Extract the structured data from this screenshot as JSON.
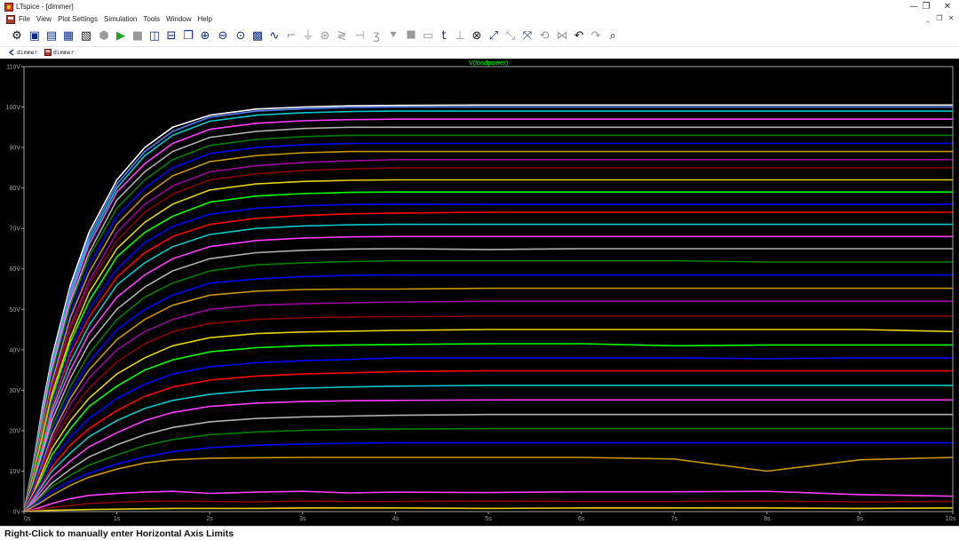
{
  "window": {
    "title": "LTspice - [dimmer]",
    "minimize_label": "—",
    "restore_label": "❐",
    "close_label": "✕"
  },
  "menubar": {
    "items": [
      "File",
      "View",
      "Plot Settings",
      "Simulation",
      "Tools",
      "Window",
      "Help"
    ],
    "mdi_minimize": "_",
    "mdi_restore": "❐",
    "mdi_close": "✕"
  },
  "toolbar": {
    "icons": [
      {
        "name": "control-panel-icon",
        "glyph": "⚙",
        "color": "#111111"
      },
      {
        "name": "new-schematic-icon",
        "glyph": "▣",
        "color": "#0b2d8a"
      },
      {
        "name": "open-file-icon",
        "glyph": "▤",
        "color": "#0b2d8a"
      },
      {
        "name": "save-icon",
        "glyph": "▦",
        "color": "#0b2d8a"
      },
      {
        "name": "print-icon",
        "glyph": "▧",
        "color": "#1a1a1a"
      },
      {
        "name": "halt-icon",
        "glyph": "⬢",
        "color": "#9a9a9a"
      },
      {
        "name": "run-icon",
        "glyph": "▶",
        "color": "#1fa51f"
      },
      {
        "name": "stop-icon",
        "glyph": "■",
        "color": "#9a9a9a"
      },
      {
        "name": "tile-vertical-icon",
        "glyph": "◫",
        "color": "#0b2d8a"
      },
      {
        "name": "tile-horizontal-icon",
        "glyph": "⊟",
        "color": "#0b2d8a"
      },
      {
        "name": "cascade-icon",
        "glyph": "❐",
        "color": "#0b2d8a"
      },
      {
        "name": "zoom-in-icon",
        "glyph": "⊕",
        "color": "#0b2d8a"
      },
      {
        "name": "zoom-out-icon",
        "glyph": "⊖",
        "color": "#0b2d8a"
      },
      {
        "name": "zoom-fit-icon",
        "glyph": "⊙",
        "color": "#0b2d8a"
      },
      {
        "name": "autorange-icon",
        "glyph": "▩",
        "color": "#0b2d8a"
      },
      {
        "name": "waveform-icon",
        "glyph": "∿",
        "color": "#0b2d8a"
      },
      {
        "name": "wire-icon",
        "glyph": "⌐",
        "color": "#9a9a9a"
      },
      {
        "name": "ground-icon",
        "glyph": "⏚",
        "color": "#9a9a9a"
      },
      {
        "name": "label-net-icon",
        "glyph": "⊛",
        "color": "#9a9a9a"
      },
      {
        "name": "resistor-icon",
        "glyph": "≷",
        "color": "#9a9a9a"
      },
      {
        "name": "capacitor-icon",
        "glyph": "⊣",
        "color": "#9a9a9a"
      },
      {
        "name": "inductor-icon",
        "glyph": "ʒ",
        "color": "#9a9a9a"
      },
      {
        "name": "diode-icon",
        "glyph": "⯆",
        "color": "#9a9a9a"
      },
      {
        "name": "component-icon",
        "glyph": "⯀",
        "color": "#9a9a9a"
      },
      {
        "name": "net-name-icon",
        "glyph": "▭",
        "color": "#9a9a9a"
      },
      {
        "name": "text-icon",
        "glyph": "t",
        "color": "#0b2d8a"
      },
      {
        "name": "spice-directive-icon",
        "glyph": "⊥",
        "color": "#9a9a9a"
      },
      {
        "name": "delete-icon",
        "glyph": "⊗",
        "color": "#111111"
      },
      {
        "name": "duplicate-icon",
        "glyph": "⤢",
        "color": "#0b2d8a"
      },
      {
        "name": "move-icon",
        "glyph": "⤡",
        "color": "#9a9a9a"
      },
      {
        "name": "drag-icon",
        "glyph": "⤧",
        "color": "#0b2d8a"
      },
      {
        "name": "rotate-icon",
        "glyph": "⟲",
        "color": "#9a9a9a"
      },
      {
        "name": "mirror-icon",
        "glyph": "⋈",
        "color": "#9a9a9a"
      },
      {
        "name": "undo-icon",
        "glyph": "↶",
        "color": "#111111"
      },
      {
        "name": "redo-icon",
        "glyph": "↷",
        "color": "#9a9a9a"
      },
      {
        "name": "find-icon",
        "glyph": "⌕",
        "color": "#111111"
      }
    ]
  },
  "tabs": [
    {
      "label": "dimmer",
      "icon": "schematic-tab-icon"
    },
    {
      "label": "dimmer",
      "icon": "waveform-tab-icon"
    }
  ],
  "plot": {
    "trace_label": "V(loadpower)",
    "trace_label_color": "#00ff00",
    "background": "#000000",
    "axis_color": "#a0a0a0"
  },
  "status": {
    "message": "Right-Click to manually enter Horizontal Axis Limits"
  },
  "chart_data": {
    "type": "line",
    "title": "V(loadpower)",
    "xlabel": "",
    "ylabel": "",
    "xlim": [
      0,
      10
    ],
    "ylim": [
      0,
      110
    ],
    "x_ticks": [
      "0s",
      "1s",
      "2s",
      "3s",
      "4s",
      "5s",
      "6s",
      "7s",
      "8s",
      "9s",
      "10s"
    ],
    "y_ticks": [
      "0V",
      "10V",
      "20V",
      "30V",
      "40V",
      "50V",
      "60V",
      "70V",
      "80V",
      "90V",
      "100V",
      "110V"
    ],
    "grid": false,
    "legend": "none",
    "x": [
      0,
      0.1,
      0.2,
      0.3,
      0.5,
      0.7,
      1.0,
      1.3,
      1.6,
      2.0,
      2.5,
      3.0,
      3.5,
      4.0,
      5.0,
      6.0,
      7.0,
      8.0,
      9.0,
      10.0
    ],
    "series": [
      {
        "color": "#ffffff",
        "values": [
          0,
          12,
          26,
          38,
          56,
          69,
          82,
          90,
          95,
          98,
          99.5,
          100,
          100.3,
          100.4,
          100.5,
          100.5,
          100.5,
          100.5,
          100.5,
          100.5
        ]
      },
      {
        "color": "#4f7fff",
        "values": [
          0,
          12,
          25,
          37,
          55,
          68,
          81,
          89,
          94,
          97.5,
          99,
          99.6,
          99.9,
          100,
          100,
          100,
          100,
          100,
          100,
          100
        ]
      },
      {
        "color": "#00c8c8",
        "values": [
          0,
          11.5,
          25,
          37,
          54,
          67,
          80,
          88,
          93,
          96.5,
          98,
          98.6,
          98.9,
          99,
          99,
          99,
          99,
          99,
          99,
          99
        ]
      },
      {
        "color": "#ff3cff",
        "values": [
          0,
          11,
          24,
          36,
          53,
          66,
          79,
          86,
          91,
          94.5,
          96,
          96.6,
          96.9,
          97,
          97,
          97,
          97,
          97,
          97,
          97
        ]
      },
      {
        "color": "#b0b0b0",
        "values": [
          0,
          11,
          23,
          35,
          52,
          64,
          77,
          84,
          89,
          92.5,
          94,
          94.7,
          95,
          95,
          95,
          95,
          95,
          95,
          95,
          95
        ]
      },
      {
        "color": "#007f00",
        "values": [
          0,
          10.5,
          22,
          34,
          51,
          63,
          75,
          82,
          87,
          90.5,
          92,
          92.7,
          93,
          93,
          93,
          93,
          93,
          93,
          93,
          93
        ]
      },
      {
        "color": "#0000ff",
        "values": [
          0,
          10,
          21,
          33,
          49,
          61,
          73,
          80,
          85,
          88.5,
          90,
          90.7,
          91,
          91,
          91,
          91,
          91,
          91,
          91,
          91
        ]
      },
      {
        "color": "#c89600",
        "values": [
          0,
          10,
          21,
          32,
          48,
          59,
          71,
          78,
          83,
          86.5,
          88,
          88.7,
          89,
          89,
          89,
          89,
          89,
          89,
          89,
          89
        ]
      },
      {
        "color": "#9b009b",
        "values": [
          0,
          9.5,
          20,
          31,
          46,
          57,
          69,
          76,
          80.5,
          84,
          85.5,
          86.3,
          86.7,
          87,
          87,
          87,
          87,
          87,
          87,
          87
        ]
      },
      {
        "color": "#8b0000",
        "values": [
          0,
          9,
          19,
          30,
          45,
          56,
          67,
          74,
          78.5,
          82,
          83.5,
          84.3,
          84.7,
          85,
          85,
          85,
          85,
          85,
          85,
          85
        ]
      },
      {
        "color": "#e6d200",
        "values": [
          0,
          9,
          19,
          29,
          43,
          54,
          65,
          71.5,
          76,
          79.5,
          81,
          81.6,
          81.9,
          82,
          82,
          82,
          82,
          82,
          82,
          82
        ]
      },
      {
        "color": "#00ff00",
        "values": [
          0,
          8.5,
          18,
          28,
          42,
          52,
          63,
          69,
          73,
          76.5,
          78,
          78.6,
          78.9,
          79,
          79,
          79,
          79,
          79,
          79,
          79
        ]
      },
      {
        "color": "#0000ff",
        "values": [
          0,
          8,
          17,
          27,
          40,
          50,
          60,
          66.5,
          70.5,
          73.5,
          75,
          75.6,
          75.9,
          76,
          76,
          76,
          76,
          76,
          76,
          76
        ]
      },
      {
        "color": "#ff0000",
        "values": [
          0,
          8,
          17,
          26,
          39,
          48,
          58,
          64,
          68,
          71,
          72.5,
          73.2,
          73.6,
          73.8,
          74,
          74,
          74,
          74,
          74,
          74
        ]
      },
      {
        "color": "#00c8c8",
        "values": [
          0,
          7.5,
          16,
          25,
          37,
          46,
          56,
          61.5,
          65.5,
          68.5,
          70,
          70.6,
          70.9,
          71,
          71,
          71,
          71,
          71,
          71,
          71
        ]
      },
      {
        "color": "#ff3cff",
        "values": [
          0,
          7,
          15,
          24,
          35,
          44,
          53,
          58.5,
          62.5,
          65.5,
          67,
          67.6,
          67.9,
          68,
          68,
          68,
          68,
          68,
          68,
          68
        ]
      },
      {
        "color": "#b0b0b0",
        "values": [
          0,
          7,
          14.5,
          22.5,
          33,
          41.5,
          50,
          55.5,
          59.5,
          62.5,
          64,
          64.6,
          64.9,
          65,
          64.8,
          65,
          65,
          65,
          65,
          65
        ]
      },
      {
        "color": "#007f00",
        "values": [
          0,
          6.5,
          13.5,
          21,
          31,
          39,
          47.5,
          53,
          56.5,
          59.5,
          61,
          61.5,
          61.8,
          62,
          62,
          62,
          62,
          61.7,
          61.7,
          61.7
        ]
      },
      {
        "color": "#0000ff",
        "values": [
          0,
          6,
          13,
          20,
          29.5,
          37,
          45,
          50,
          53.5,
          56.5,
          57.5,
          58.1,
          58.4,
          58.5,
          58.5,
          58.5,
          58.5,
          58.5,
          58.5,
          58.5
        ]
      },
      {
        "color": "#c89600",
        "values": [
          0,
          5.5,
          12,
          19,
          28,
          35,
          42.5,
          47.5,
          51,
          53.5,
          54.5,
          54.9,
          55,
          55,
          55.2,
          55.2,
          55.2,
          55.2,
          55.2,
          55.2
        ]
      },
      {
        "color": "#9b009b",
        "values": [
          0,
          5.5,
          11.5,
          18,
          26.5,
          33,
          40,
          44.5,
          47.5,
          50,
          51,
          51.4,
          51.6,
          51.8,
          52,
          52,
          52,
          52,
          52,
          52
        ]
      },
      {
        "color": "#8b0000",
        "values": [
          0,
          5,
          10.5,
          17,
          24.5,
          30.5,
          37,
          41.5,
          44.5,
          46.5,
          47.5,
          47.9,
          48.1,
          48.2,
          48.3,
          48.3,
          48.3,
          48.3,
          48.3,
          48.3
        ]
      },
      {
        "color": "#e6d200",
        "values": [
          0,
          4.5,
          10,
          15.5,
          22.5,
          28,
          34,
          38,
          41,
          43,
          44,
          44.4,
          44.6,
          44.8,
          45,
          45,
          45,
          45,
          45,
          44.5
        ]
      },
      {
        "color": "#00ff00",
        "values": [
          0,
          4,
          9,
          14,
          20.5,
          26,
          31,
          35,
          37.5,
          39.5,
          40.5,
          41,
          41.2,
          41.3,
          41.5,
          41.5,
          41,
          41.2,
          41.2,
          41.2
        ]
      },
      {
        "color": "#0000ff",
        "values": [
          0,
          4,
          8,
          12.5,
          18.5,
          23,
          28,
          31.5,
          34,
          35.8,
          36.8,
          37.3,
          37.6,
          38,
          38,
          38,
          38,
          37.8,
          38,
          38
        ]
      },
      {
        "color": "#ff0000",
        "values": [
          0,
          3.5,
          7,
          11,
          16.5,
          20.5,
          25,
          28.5,
          30.8,
          32.5,
          33.5,
          34,
          34.3,
          34.6,
          34.8,
          34.8,
          34.8,
          34.8,
          34.8,
          34.8
        ]
      },
      {
        "color": "#00c8c8",
        "values": [
          0,
          3,
          6.5,
          10,
          14.5,
          18.5,
          22.5,
          25.5,
          27.5,
          29,
          30,
          30.5,
          30.8,
          31,
          31.2,
          31.2,
          31.2,
          31.2,
          31.2,
          31.2
        ]
      },
      {
        "color": "#ff3cff",
        "values": [
          0,
          2.5,
          5.5,
          8.5,
          12.5,
          16,
          19.5,
          22.5,
          24.5,
          26,
          26.8,
          27.2,
          27.4,
          27.5,
          27.6,
          27.6,
          27.6,
          27.6,
          27.6,
          27.6
        ]
      },
      {
        "color": "#b0b0b0",
        "values": [
          0,
          2,
          4.5,
          7,
          10.5,
          13.5,
          16.5,
          19,
          20.8,
          22.2,
          23,
          23.4,
          23.6,
          23.8,
          24,
          24,
          24,
          24,
          24,
          24
        ]
      },
      {
        "color": "#007f00",
        "values": [
          0,
          1.8,
          4,
          6.2,
          9,
          11.5,
          14,
          16.3,
          17.8,
          19,
          19.7,
          20.1,
          20.3,
          20.4,
          20.5,
          20.5,
          20.5,
          20.5,
          20.5,
          20.5
        ]
      },
      {
        "color": "#0000ff",
        "values": [
          0,
          1.5,
          3.2,
          5,
          7.5,
          9.5,
          11.8,
          13.5,
          14.8,
          15.8,
          16.4,
          16.7,
          16.9,
          17,
          17,
          17,
          17,
          17,
          17,
          17
        ]
      },
      {
        "color": "#c89600",
        "values": [
          0,
          1.2,
          2.5,
          4,
          6.5,
          8.5,
          10.5,
          12,
          12.8,
          13.2,
          13.3,
          13.4,
          13.4,
          13.4,
          13.4,
          13.4,
          13,
          10,
          12.8,
          13.4
        ]
      },
      {
        "color": "#ff3cff",
        "values": [
          0,
          0.5,
          1.2,
          2,
          3.2,
          4,
          4.5,
          4.8,
          5,
          4.5,
          4.8,
          5,
          4.6,
          4.8,
          4.7,
          4.9,
          4.9,
          5,
          4.2,
          3.8
        ]
      },
      {
        "color": "#8b0000",
        "values": [
          0,
          0.3,
          0.7,
          1,
          1.5,
          2,
          2.3,
          2.5,
          2.6,
          2.5,
          2.4,
          2.6,
          2.5,
          2.5,
          2.6,
          2.5,
          2.5,
          2.6,
          2.4,
          2.5
        ]
      },
      {
        "color": "#e6d200",
        "values": [
          0,
          0.1,
          0.2,
          0.3,
          0.4,
          0.5,
          0.6,
          0.7,
          0.8,
          0.8,
          0.8,
          0.9,
          0.9,
          0.9,
          0.8,
          0.9,
          0.9,
          0.9,
          0.8,
          0.9
        ]
      }
    ]
  }
}
